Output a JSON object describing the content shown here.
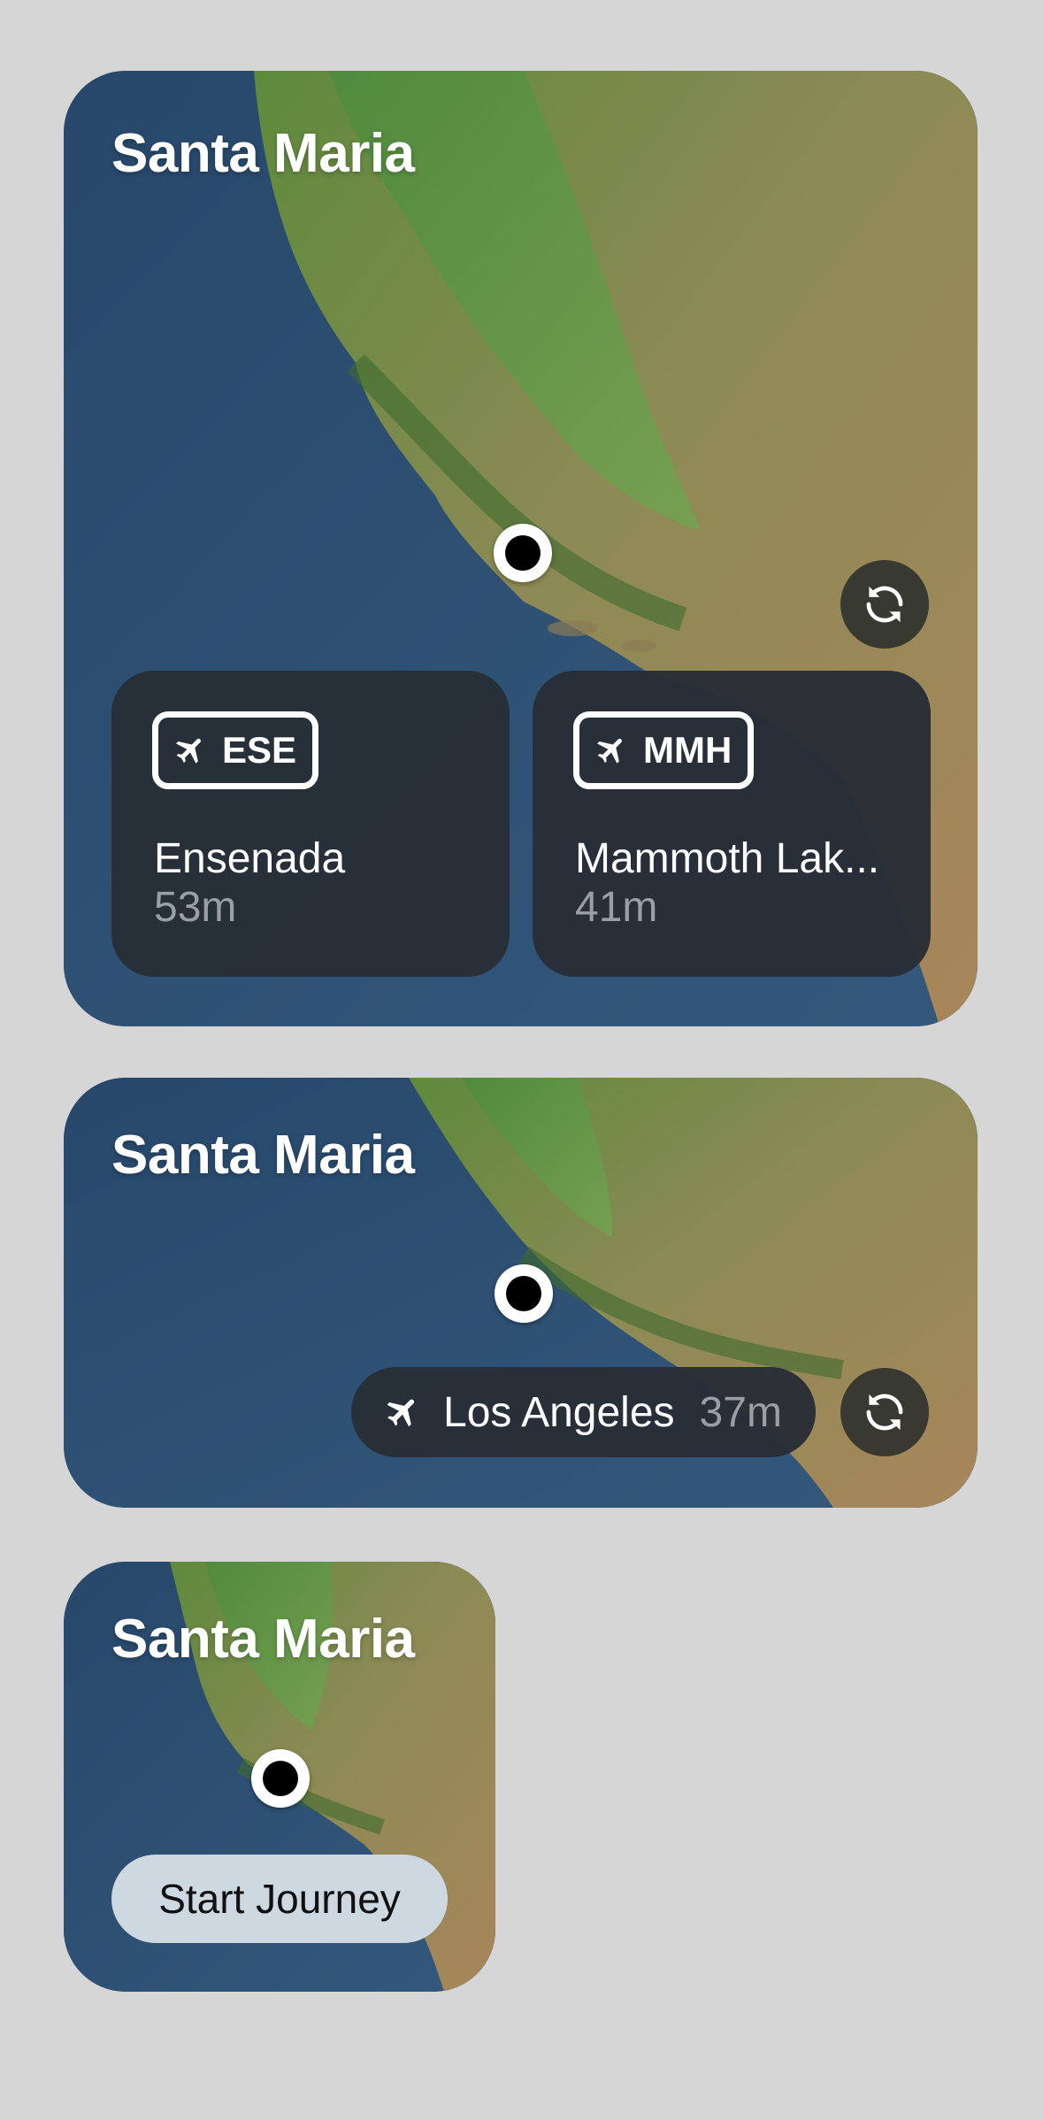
{
  "colors": {
    "background": "#d6d6d6",
    "ocean": "#2e5377",
    "card": "#282e36",
    "secondary_text": "#9a9ea6",
    "button": "#cdd8e0"
  },
  "large_widget": {
    "city": "Santa Maria",
    "refresh_icon": "refresh-icon",
    "destinations": [
      {
        "code": "ESE",
        "name": "Ensenada",
        "time": "53m",
        "icon": "airplane-icon"
      },
      {
        "code": "MMH",
        "name": "Mammoth Lak...",
        "time": "41m",
        "icon": "airplane-icon"
      }
    ]
  },
  "medium_widget": {
    "city": "Santa Maria",
    "destination": {
      "name": "Los Angeles",
      "time": "37m",
      "icon": "airplane-icon"
    },
    "refresh_icon": "refresh-icon"
  },
  "small_widget": {
    "city": "Santa Maria",
    "button_label": "Start Journey"
  }
}
